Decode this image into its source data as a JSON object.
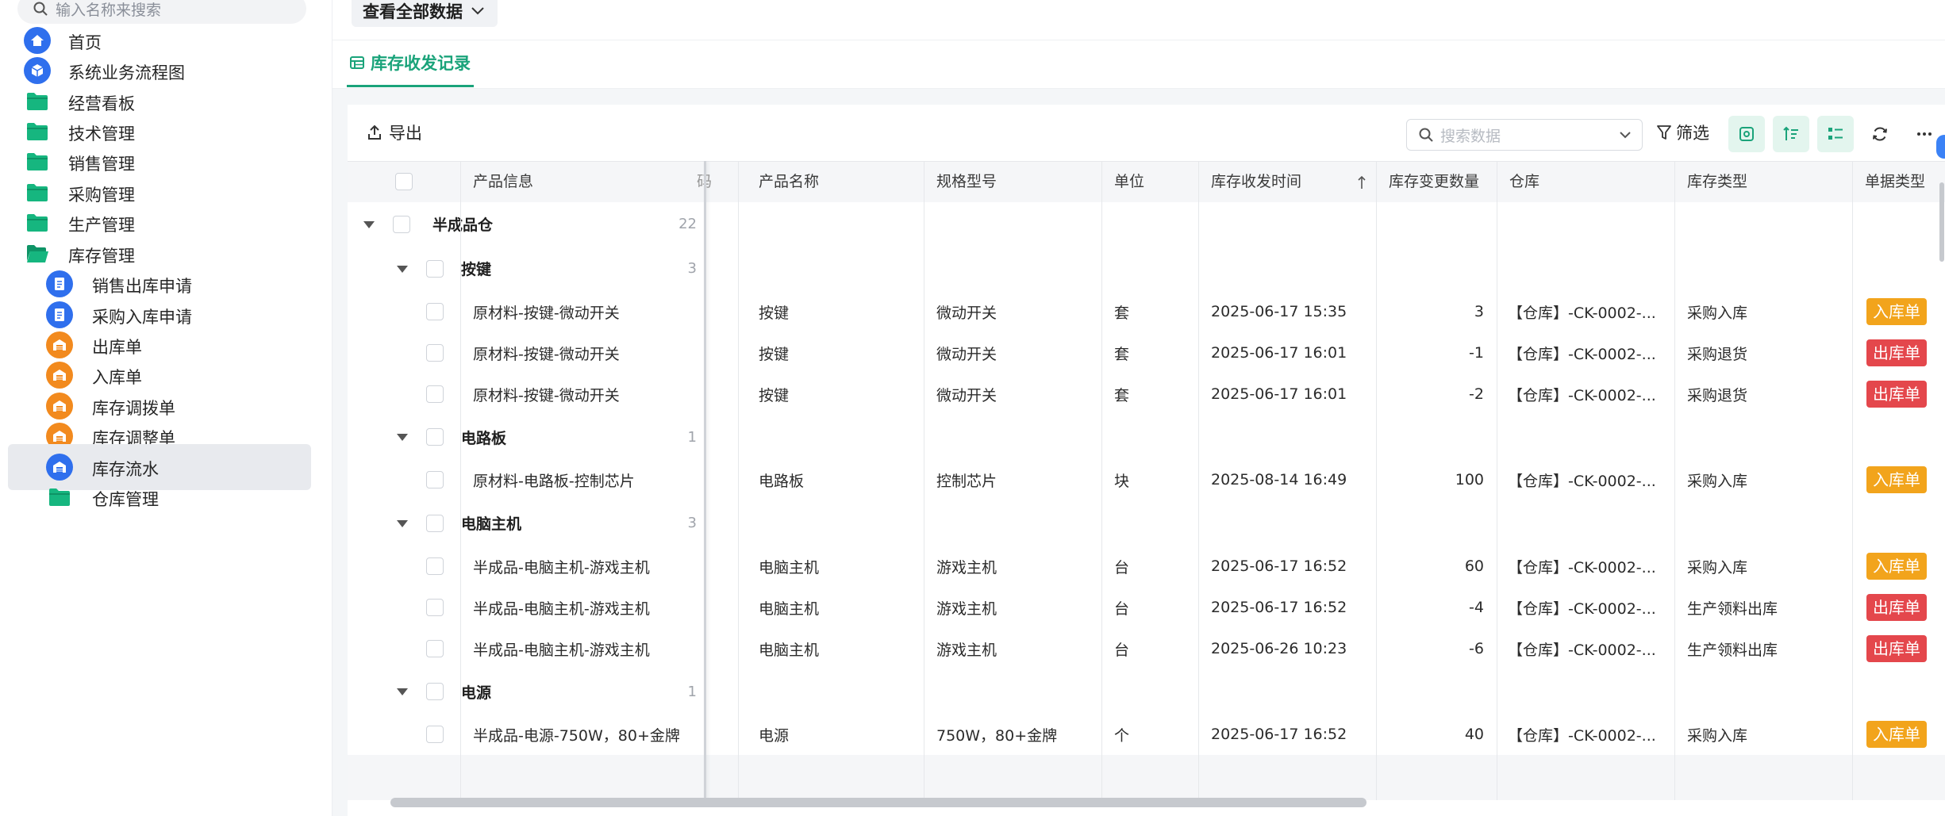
{
  "sidebar": {
    "search_placeholder": "输入名称来搜索",
    "items": [
      {
        "label": "首页",
        "icon": "home-icon",
        "color": "#2f6fed"
      },
      {
        "label": "系统业务流程图",
        "icon": "cube-icon",
        "color": "#2f6fed"
      },
      {
        "label": "经营看板",
        "icon": "folder-icon",
        "color": "#16b67f"
      },
      {
        "label": "技术管理",
        "icon": "folder-icon",
        "color": "#16b67f"
      },
      {
        "label": "销售管理",
        "icon": "folder-icon",
        "color": "#16b67f"
      },
      {
        "label": "采购管理",
        "icon": "folder-icon",
        "color": "#16b67f"
      },
      {
        "label": "生产管理",
        "icon": "folder-icon",
        "color": "#16b67f"
      },
      {
        "label": "库存管理",
        "icon": "folder-open-icon",
        "color": "#16b67f"
      },
      {
        "label": "销售出库申请",
        "icon": "document-icon",
        "color": "#2f6fed"
      },
      {
        "label": "采购入库申请",
        "icon": "document-icon",
        "color": "#2f6fed"
      },
      {
        "label": "出库单",
        "icon": "warehouse-icon",
        "color": "#f28a1e"
      },
      {
        "label": "入库单",
        "icon": "warehouse-icon",
        "color": "#f28a1e"
      },
      {
        "label": "库存调拨单",
        "icon": "warehouse-icon",
        "color": "#f28a1e"
      },
      {
        "label": "库存调整单",
        "icon": "warehouse-icon",
        "color": "#f28a1e"
      },
      {
        "label": "库存流水",
        "icon": "warehouse-icon",
        "color": "#2f6fed"
      },
      {
        "label": "仓库管理",
        "icon": "folder-icon",
        "color": "#16b67f"
      }
    ]
  },
  "topbar": {
    "view_all": "查看全部数据"
  },
  "tab": {
    "label": "库存收发记录"
  },
  "toolbar": {
    "export": "导出",
    "search_placeholder": "搜索数据",
    "filter": "筛选"
  },
  "table": {
    "columns": {
      "product_info": "产品信息",
      "partial": "码",
      "product_name": "产品名称",
      "spec": "规格型号",
      "unit": "单位",
      "time": "库存收发时间",
      "qty": "库存变更数量",
      "warehouse": "仓库",
      "stock_type": "库存类型",
      "doc_type": "单据类型"
    },
    "top_group": {
      "name": "半成品仓",
      "count": "22"
    },
    "groups": [
      {
        "name": "按键",
        "count": "3",
        "rows": [
          {
            "info": "原材料-按键-微动开关",
            "name": "按键",
            "spec": "微动开关",
            "unit": "套",
            "time": "2025-06-17 15:35",
            "qty": "3",
            "warehouse": "【仓库】-CK-0002-...",
            "stock_type": "采购入库",
            "doc": "入库单",
            "doc_kind": "in"
          },
          {
            "info": "原材料-按键-微动开关",
            "name": "按键",
            "spec": "微动开关",
            "unit": "套",
            "time": "2025-06-17 16:01",
            "qty": "-1",
            "warehouse": "【仓库】-CK-0002-...",
            "stock_type": "采购退货",
            "doc": "出库单",
            "doc_kind": "out"
          },
          {
            "info": "原材料-按键-微动开关",
            "name": "按键",
            "spec": "微动开关",
            "unit": "套",
            "time": "2025-06-17 16:01",
            "qty": "-2",
            "warehouse": "【仓库】-CK-0002-...",
            "stock_type": "采购退货",
            "doc": "出库单",
            "doc_kind": "out"
          }
        ]
      },
      {
        "name": "电路板",
        "count": "1",
        "rows": [
          {
            "info": "原材料-电路板-控制芯片",
            "name": "电路板",
            "spec": "控制芯片",
            "unit": "块",
            "time": "2025-08-14 16:49",
            "qty": "100",
            "warehouse": "【仓库】-CK-0002-...",
            "stock_type": "采购入库",
            "doc": "入库单",
            "doc_kind": "in"
          }
        ]
      },
      {
        "name": "电脑主机",
        "count": "3",
        "rows": [
          {
            "info": "半成品-电脑主机-游戏主机",
            "name": "电脑主机",
            "spec": "游戏主机",
            "unit": "台",
            "time": "2025-06-17 16:52",
            "qty": "60",
            "warehouse": "【仓库】-CK-0002-...",
            "stock_type": "采购入库",
            "doc": "入库单",
            "doc_kind": "in"
          },
          {
            "info": "半成品-电脑主机-游戏主机",
            "name": "电脑主机",
            "spec": "游戏主机",
            "unit": "台",
            "time": "2025-06-17 16:52",
            "qty": "-4",
            "warehouse": "【仓库】-CK-0002-...",
            "stock_type": "生产领料出库",
            "doc": "出库单",
            "doc_kind": "out"
          },
          {
            "info": "半成品-电脑主机-游戏主机",
            "name": "电脑主机",
            "spec": "游戏主机",
            "unit": "台",
            "time": "2025-06-26 10:23",
            "qty": "-6",
            "warehouse": "【仓库】-CK-0002-...",
            "stock_type": "生产领料出库",
            "doc": "出库单",
            "doc_kind": "out"
          }
        ]
      },
      {
        "name": "电源",
        "count": "1",
        "rows": [
          {
            "info": "半成品-电源-750W，80+金牌",
            "name": "电源",
            "spec": "750W，80+金牌",
            "unit": "个",
            "time": "2025-06-17 16:52",
            "qty": "40",
            "warehouse": "【仓库】-CK-0002-...",
            "stock_type": "采购入库",
            "doc": "入库单",
            "doc_kind": "in"
          }
        ]
      }
    ]
  },
  "colors": {
    "accent": "#1aa37a",
    "badge_in": "#f2a41c",
    "badge_out": "#e4474c"
  }
}
